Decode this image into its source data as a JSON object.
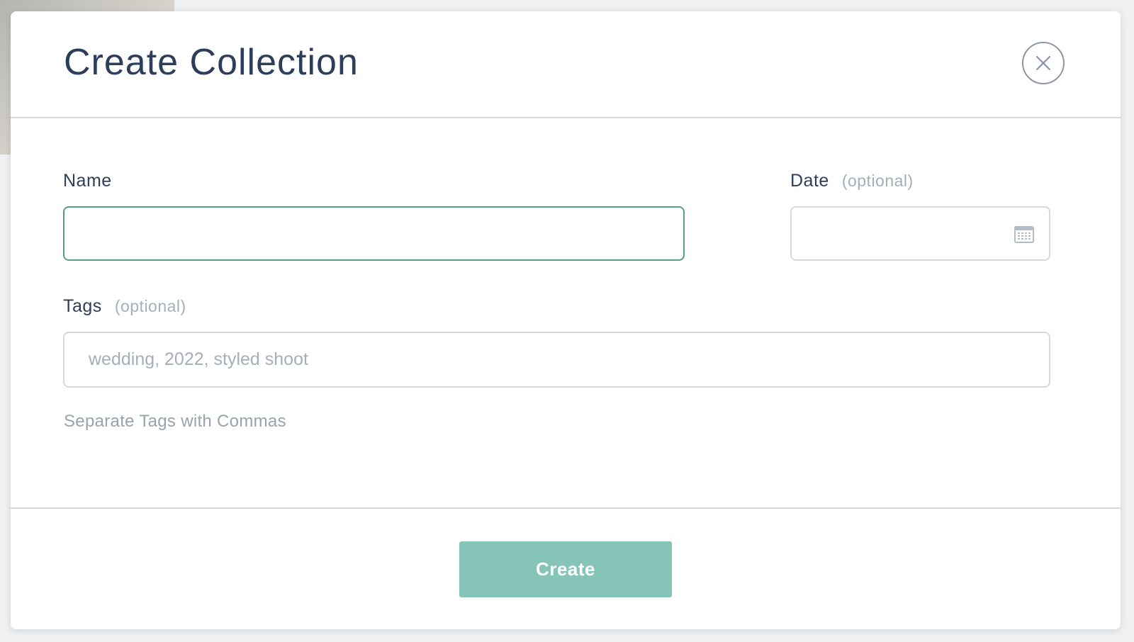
{
  "modal": {
    "title": "Create Collection",
    "close_icon": "close-icon"
  },
  "form": {
    "name": {
      "label": "Name",
      "value": "",
      "placeholder": ""
    },
    "date": {
      "label": "Date",
      "optional_text": "(optional)",
      "value": "",
      "icon": "calendar-icon"
    },
    "tags": {
      "label": "Tags",
      "optional_text": "(optional)",
      "value": "",
      "placeholder": "wedding, 2022, styled shoot",
      "help_text": "Separate Tags with Commas"
    }
  },
  "footer": {
    "create_label": "Create"
  },
  "colors": {
    "accent": "#86c4b7",
    "focus_border": "#5a9c85",
    "title_text": "#2c3e5a",
    "muted_text": "#a6aebb"
  }
}
